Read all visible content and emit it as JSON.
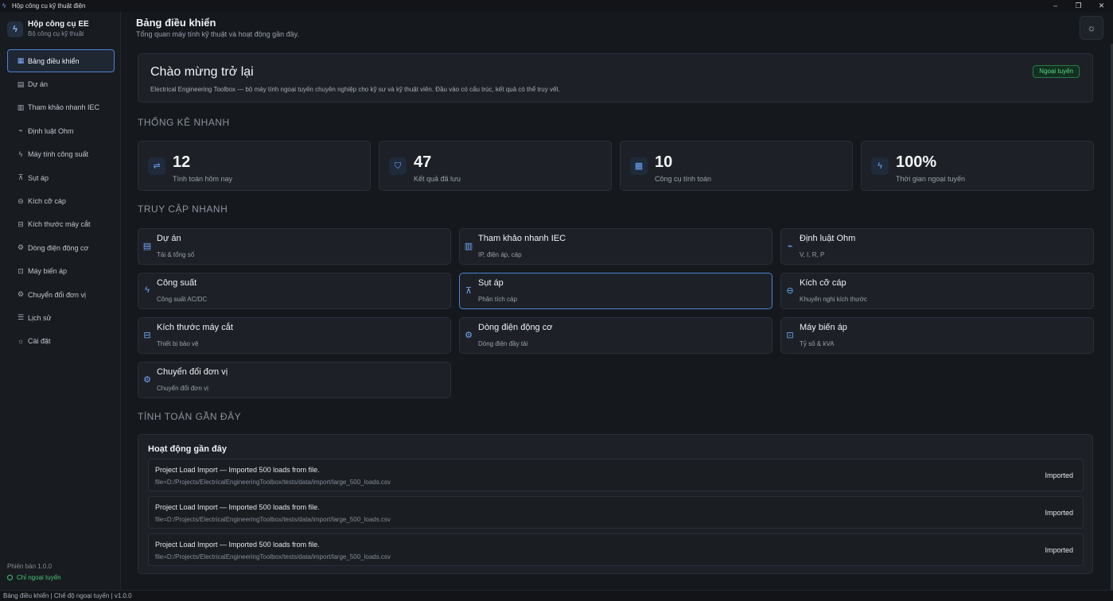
{
  "window": {
    "title": "Hộp công cụ kỹ thuật điện",
    "controls": [
      "–",
      "❐",
      "✕"
    ]
  },
  "sidebar": {
    "brand_name": "Hộp công cụ EE",
    "brand_sub": "Bộ công cụ kỹ thuật",
    "items": [
      {
        "label": "Bảng điều khiển",
        "icon": "grid-icon",
        "active": true
      },
      {
        "label": "Dự án",
        "icon": "folder-icon"
      },
      {
        "label": "Tham khảo nhanh IEC",
        "icon": "book-icon"
      },
      {
        "label": "Định luật Ohm",
        "icon": "omega-icon"
      },
      {
        "label": "Máy tính công suất",
        "icon": "bolt-icon"
      },
      {
        "label": "Sụt áp",
        "icon": "drop-icon"
      },
      {
        "label": "Kích cỡ cáp",
        "icon": "cable-icon"
      },
      {
        "label": "Kích thước máy cắt",
        "icon": "breaker-icon"
      },
      {
        "label": "Dòng điện động cơ",
        "icon": "motor-icon"
      },
      {
        "label": "Máy biến áp",
        "icon": "transformer-icon"
      },
      {
        "label": "Chuyển đổi đơn vị",
        "icon": "convert-icon"
      },
      {
        "label": "Lịch sử",
        "icon": "history-icon"
      },
      {
        "label": "Cài đặt",
        "icon": "gear-icon"
      }
    ],
    "version": "Phiên bản 1.0.0",
    "offline": "Chỉ ngoại tuyến"
  },
  "header": {
    "title": "Bảng điều khiển",
    "subtitle": "Tổng quan máy tính kỹ thuật và hoạt động gần đây."
  },
  "welcome": {
    "title": "Chào mừng trở lại",
    "text": "Electrical Engineering Toolbox — bộ máy tính ngoại tuyến chuyên nghiệp cho kỹ sư và kỹ thuật viên. Đầu vào có cấu trúc, kết quả có thể truy vết.",
    "badge": "Ngoại tuyến"
  },
  "sections": {
    "stats": "THỐNG KÊ NHANH",
    "quick": "TRUY CẬP NHANH",
    "recent": "TÍNH TOÁN GẦN ĐÂY"
  },
  "stats": [
    {
      "value": "12",
      "label": "Tính toán hôm nay",
      "icon": "sliders-icon"
    },
    {
      "value": "47",
      "label": "Kết quả đã lưu",
      "icon": "shield-icon"
    },
    {
      "value": "10",
      "label": "Công cụ tính toán",
      "icon": "grid-icon"
    },
    {
      "value": "100%",
      "label": "Thời gian ngoại tuyến",
      "icon": "bolt-icon"
    }
  ],
  "quick_access": [
    {
      "title": "Dự án",
      "sub": "Tải & tổng số",
      "icon": "folder-icon"
    },
    {
      "title": "Tham khảo nhanh IEC",
      "sub": "IP, điện áp, cáp",
      "icon": "book-icon"
    },
    {
      "title": "Định luật Ohm",
      "sub": "V, I, R, P",
      "icon": "omega-icon"
    },
    {
      "title": "Công suất",
      "sub": "Công suất AC/DC",
      "icon": "bolt-icon"
    },
    {
      "title": "Sụt áp",
      "sub": "Phân tích cáp",
      "icon": "drop-icon"
    },
    {
      "title": "Kích cỡ cáp",
      "sub": "Khuyến nghị kích thước",
      "icon": "cable-icon"
    },
    {
      "title": "Kích thước máy cắt",
      "sub": "Thiết bị bảo vệ",
      "icon": "breaker-icon"
    },
    {
      "title": "Dòng điện động cơ",
      "sub": "Dòng điện đầy tải",
      "icon": "motor-icon"
    },
    {
      "title": "Máy biến áp",
      "sub": "Tỷ số & kVA",
      "icon": "transformer-icon"
    },
    {
      "title": "Chuyển đổi đơn vị",
      "sub": "Chuyển đổi đơn vị",
      "icon": "convert-icon"
    }
  ],
  "activity": {
    "title": "Hoạt động gần đây",
    "rows": [
      {
        "text": "Project Load Import — Imported 500 loads from file.",
        "detail": "file=D:/Projects/ElectricalEngineeringToolbox/tests/data/import/large_500_loads.csv",
        "status": "Imported"
      },
      {
        "text": "Project Load Import — Imported 500 loads from file.",
        "detail": "file=D:/Projects/ElectricalEngineeringToolbox/tests/data/import/large_500_loads.csv",
        "status": "Imported"
      },
      {
        "text": "Project Load Import — Imported 500 loads from file.",
        "detail": "file=D:/Projects/ElectricalEngineeringToolbox/tests/data/import/large_500_loads.csv",
        "status": "Imported"
      }
    ]
  },
  "statusbar": "Bảng điều khiển |  Chế độ ngoại tuyến |  v1.0.0",
  "colors": {
    "accent": "#4b83d6",
    "success": "#48c774",
    "background": "#15181d"
  }
}
